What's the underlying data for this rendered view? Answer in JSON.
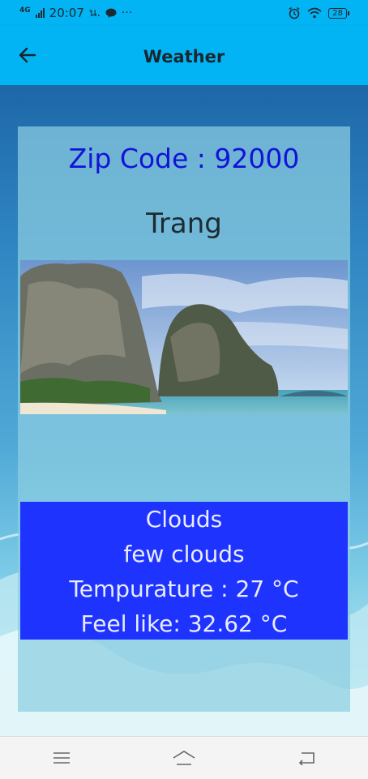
{
  "status_bar": {
    "network": "4G",
    "time": "20:07",
    "carrier_text": "น.",
    "more": "···",
    "battery": "28",
    "icons": [
      "signal-icon",
      "line-app-icon",
      "alarm-icon",
      "wifi-icon",
      "battery-icon"
    ]
  },
  "app_bar": {
    "title": "Weather",
    "back_icon": "arrow-back-icon"
  },
  "card": {
    "zip_label": "Zip Code : 92000",
    "city": "Trang",
    "photo": "coastal limestone cliffs and beach",
    "weather_main": "Clouds",
    "weather_description": "few clouds",
    "temperature": "Tempurature : 27 °C",
    "feels_like": "Feel like: 32.62 °C"
  },
  "colors": {
    "app_bar": "#03b4f4",
    "zip_text": "#1313d8",
    "info_panel": "#1f33ff"
  },
  "nav_bar": {
    "icons": [
      "menu-icon",
      "home-icon",
      "back-nav-icon"
    ]
  }
}
